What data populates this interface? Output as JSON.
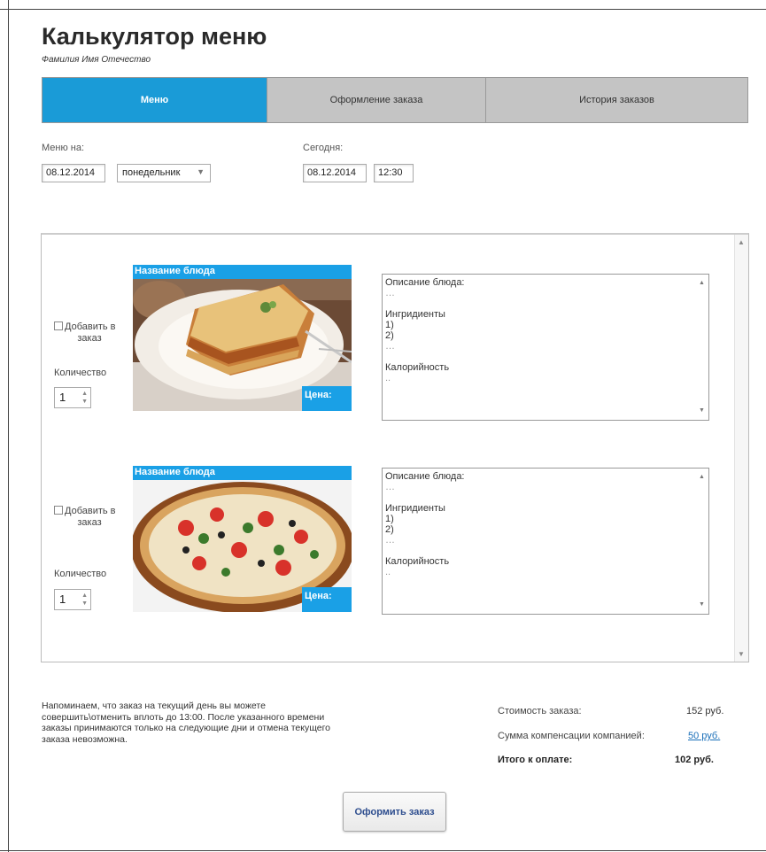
{
  "app": {
    "title": "Калькулятор меню",
    "subtitle": "Фамилия Имя Отечество"
  },
  "tabs": [
    {
      "label": "Меню",
      "active": true
    },
    {
      "label": "Оформление заказа",
      "active": false
    },
    {
      "label": "История заказов",
      "active": false
    }
  ],
  "menu_for": {
    "label": "Меню на:",
    "date": "08.12.2014",
    "weekday": "понедельник"
  },
  "today": {
    "label": "Сегодня:",
    "date": "08.12.2014",
    "time": "12:30"
  },
  "dishes": [
    {
      "name": "Название блюда",
      "price_label": "Цена:",
      "image": "lasagna",
      "add_label_1": "Добавить в",
      "add_label_2": "заказ",
      "add_checked": false,
      "qty_label": "Количество",
      "qty": "1",
      "desc_title": "Описание блюда:",
      "desc_dots_1": "…",
      "ingredients_label": "Ингридиенты",
      "ingredient_1": "1)",
      "ingredient_2": "2)",
      "desc_dots_2": "…",
      "calories_label": "Калорийность",
      "desc_dots_3": ".."
    },
    {
      "name": "Название блюда",
      "price_label": "Цена:",
      "image": "pizza",
      "add_label_1": "Добавить в",
      "add_label_2": "заказ",
      "add_checked": false,
      "qty_label": "Количество",
      "qty": "1",
      "desc_title": "Описание блюда:",
      "desc_dots_1": "…",
      "ingredients_label": "Ингридиенты",
      "ingredient_1": "1)",
      "ingredient_2": "2)",
      "desc_dots_2": "…",
      "calories_label": "Калорийность",
      "desc_dots_3": ".."
    }
  ],
  "note": "Напоминаем, что заказ на текущий день вы можете совершить\\отменить вплоть до 13:00. После указанного времени заказы принимаются только на следующие дни и отмена текущего заказа невозможна.",
  "summary": {
    "cost_label": "Стоимость заказа:",
    "cost_value": "152 руб.",
    "compensation_label": "Сумма компенсации компанией:",
    "compensation_value": "50 руб.",
    "total_label": "Итого к оплате:",
    "total_value": "102 руб."
  },
  "submit_label": "Оформить заказ",
  "colors": {
    "accent": "#1a9bd7",
    "tab_inactive": "#c4c4c4",
    "link": "#1a6fb9"
  }
}
